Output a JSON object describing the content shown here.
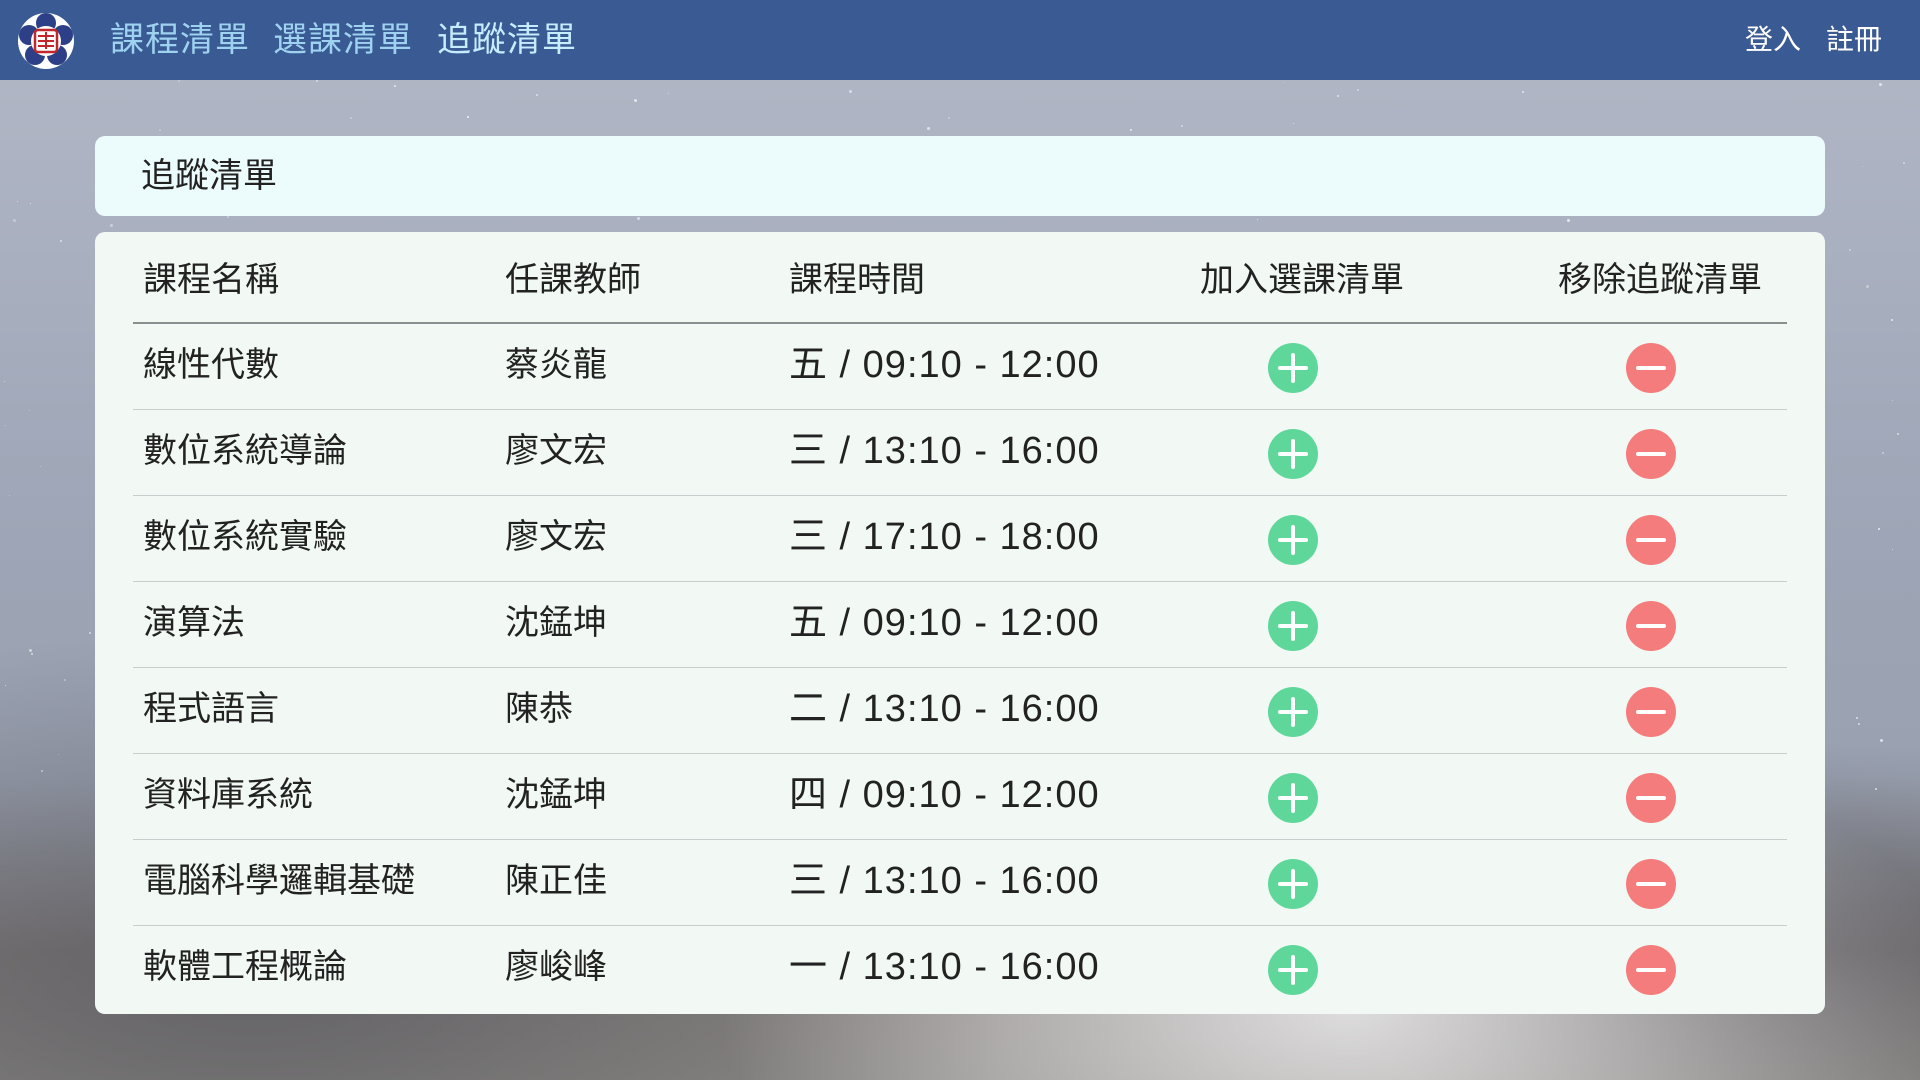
{
  "navbar": {
    "logo_icon": "school-seal-logo",
    "links": [
      {
        "label": "課程清單",
        "active": false
      },
      {
        "label": "選課清單",
        "active": false
      },
      {
        "label": "追蹤清單",
        "active": true
      }
    ],
    "login_label": "登入",
    "register_label": "註冊",
    "colors": {
      "bar": "#3a5a93",
      "link": "#9fd2f0",
      "active_link": "#c6ecff"
    }
  },
  "page_title": "追蹤清單",
  "table": {
    "headers": {
      "name": "課程名稱",
      "teacher": "任課教師",
      "time": "課程時間",
      "add": "加入選課清單",
      "remove": "移除追蹤清單"
    },
    "rows": [
      {
        "name": "線性代數",
        "teacher": "蔡炎龍",
        "time": "五 / 09:10 - 12:00"
      },
      {
        "name": "數位系統導論",
        "teacher": "廖文宏",
        "time": "三 / 13:10 - 16:00"
      },
      {
        "name": "數位系統實驗",
        "teacher": "廖文宏",
        "time": "三 / 17:10 - 18:00"
      },
      {
        "name": "演算法",
        "teacher": "沈錳坤",
        "time": "五 / 09:10 - 12:00"
      },
      {
        "name": "程式語言",
        "teacher": "陳恭",
        "time": "二 / 13:10 - 16:00"
      },
      {
        "name": "資料庫系統",
        "teacher": "沈錳坤",
        "time": "四 / 09:10 - 12:00"
      },
      {
        "name": "電腦科學邏輯基礎",
        "teacher": "陳正佳",
        "time": "三 / 13:10 - 16:00"
      },
      {
        "name": "軟體工程概論",
        "teacher": "廖峻峰",
        "time": "一 / 13:10 - 16:00"
      }
    ],
    "add_icon": "plus-circle-icon",
    "remove_icon": "minus-circle-icon",
    "colors": {
      "add": "#5fd79b",
      "remove": "#f47c7c"
    }
  }
}
